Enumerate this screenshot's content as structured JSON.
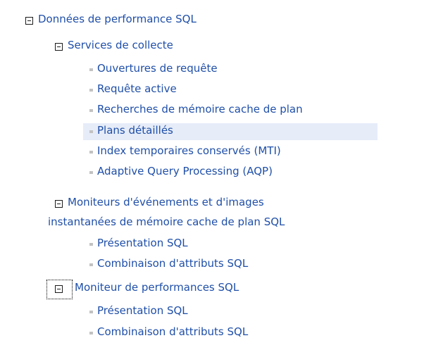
{
  "tree": {
    "root": {
      "label": "Données de performance SQL",
      "collection_services": {
        "label": "Services de collecte",
        "items": [
          "Ouvertures de requête",
          "Requête active",
          "Recherches de mémoire cache de plan",
          "Plans détaillés",
          "Index temporaires conservés (MTI)",
          "Adaptive Query Processing (AQP)"
        ]
      },
      "event_monitors": {
        "label_line1": "Moniteurs d'événements et d'images",
        "label_line2": "instantanées de mémoire cache de plan SQL",
        "items": [
          "Présentation SQL",
          "Combinaison d'attributs SQL"
        ]
      },
      "performance_monitor": {
        "label": "Moniteur de performances SQL",
        "items": [
          "Présentation SQL",
          "Combinaison d'attributs SQL"
        ]
      }
    },
    "selected_item": "Plans détaillés"
  },
  "colors": {
    "link": "#1f4fa8",
    "selection": "#e6ecf8",
    "bullet": "#c2c2c2",
    "toggle_border": "#1a1a1a"
  },
  "icons": {
    "expanded_toggle": "minus-box-icon",
    "leaf_bullet": "square-bullet-icon"
  }
}
